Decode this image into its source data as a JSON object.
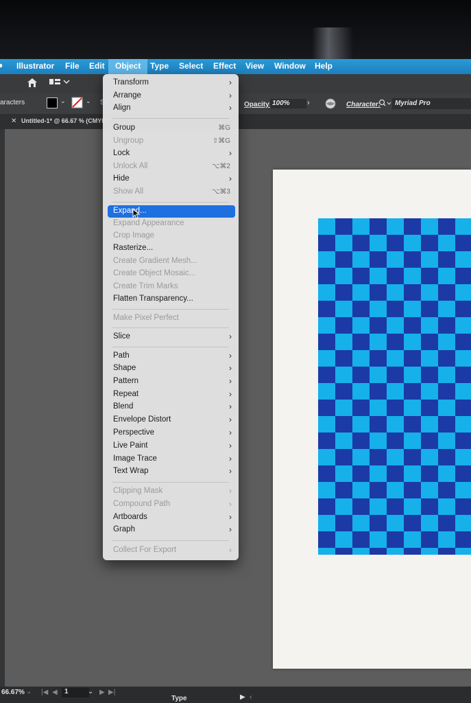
{
  "menubar": {
    "items": [
      "Illustrator",
      "File",
      "Edit",
      "Object",
      "Type",
      "Select",
      "Effect",
      "View",
      "Window",
      "Help"
    ],
    "active": "Object"
  },
  "control_bar": {
    "left_label": "aracters",
    "stroke_label_partial": "St",
    "opacity_label": "Opacity:",
    "opacity_value": "100%",
    "character_label": "Character:",
    "font_value": "Myriad Pro"
  },
  "document_tab": {
    "title": "Untitled-1* @ 66.67 % (CMYK"
  },
  "object_menu": {
    "items": [
      {
        "label": "Transform",
        "submenu": true
      },
      {
        "label": "Arrange",
        "submenu": true
      },
      {
        "label": "Align",
        "submenu": true
      },
      {
        "label": "Group",
        "shortcut": "⌘G"
      },
      {
        "label": "Ungroup",
        "shortcut": "⇧⌘G",
        "disabled": true
      },
      {
        "label": "Lock",
        "submenu": true
      },
      {
        "label": "Unlock All",
        "shortcut": "⌥⌘2",
        "disabled": true
      },
      {
        "label": "Hide",
        "submenu": true
      },
      {
        "label": "Show All",
        "shortcut": "⌥⌘3",
        "disabled": true
      },
      {
        "label": "Expand...",
        "highlighted": true
      },
      {
        "label": "Expand Appearance",
        "disabled": true
      },
      {
        "label": "Crop Image",
        "disabled": true
      },
      {
        "label": "Rasterize..."
      },
      {
        "label": "Create Gradient Mesh...",
        "disabled": true
      },
      {
        "label": "Create Object Mosaic...",
        "disabled": true
      },
      {
        "label": "Create Trim Marks",
        "disabled": true
      },
      {
        "label": "Flatten Transparency..."
      },
      {
        "label": "Make Pixel Perfect",
        "disabled": true
      },
      {
        "label": "Slice",
        "submenu": true
      },
      {
        "label": "Path",
        "submenu": true
      },
      {
        "label": "Shape",
        "submenu": true
      },
      {
        "label": "Pattern",
        "submenu": true
      },
      {
        "label": "Repeat",
        "submenu": true
      },
      {
        "label": "Blend",
        "submenu": true
      },
      {
        "label": "Envelope Distort",
        "submenu": true
      },
      {
        "label": "Perspective",
        "submenu": true
      },
      {
        "label": "Live Paint",
        "submenu": true
      },
      {
        "label": "Image Trace",
        "submenu": true
      },
      {
        "label": "Text Wrap",
        "submenu": true
      },
      {
        "label": "Clipping Mask",
        "submenu": true,
        "disabled": true
      },
      {
        "label": "Compound Path",
        "submenu": true,
        "disabled": true
      },
      {
        "label": "Artboards",
        "submenu": true
      },
      {
        "label": "Graph",
        "submenu": true
      },
      {
        "label": "Collect For Export",
        "submenu": true,
        "disabled": true
      }
    ]
  },
  "status_bar": {
    "zoom": "66.67%",
    "artboard_number": "1",
    "tool_label": "Type"
  },
  "colors": {
    "menubar": "#1f86c8",
    "highlight": "#1e6fe0",
    "checker_dark": "#1c3aa6",
    "checker_light": "#16b0ea"
  }
}
